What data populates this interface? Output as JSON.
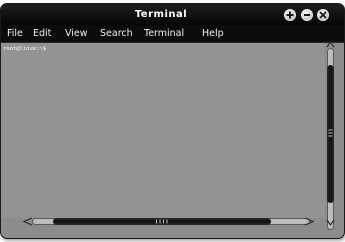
{
  "window": {
    "title": "Terminal",
    "buttons": {
      "add_icon": "plus-icon",
      "minimize_icon": "minus-icon",
      "close_icon": "close-icon"
    }
  },
  "menubar": {
    "items": [
      "File",
      "Edit",
      "View",
      "Search",
      "Terminal",
      "Help"
    ]
  },
  "terminal": {
    "prompt": "root@linux:~$"
  },
  "scrollbars": {
    "vertical_grip_icon": "grip-icon",
    "horizontal_grip_icon": "grip-icon"
  },
  "colors": {
    "titlebar": "#0a0a0a",
    "menubar": "#0c0c0c",
    "terminal_bg": "#939393",
    "text": "#ffffff"
  }
}
